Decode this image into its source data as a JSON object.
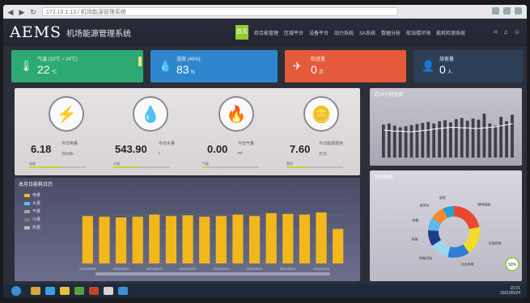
{
  "browser": {
    "url": "172.15.1.13 / 机场能源管理系统"
  },
  "header": {
    "logo": "AEMS",
    "system_name": "机场能源管理系统",
    "home_button": "首页",
    "menu": [
      "综合能管理",
      "区域平台",
      "设备平台",
      "动力系统",
      "SA系统",
      "数据分析",
      "航站楼环境",
      "能耗检测系统"
    ]
  },
  "kpis": [
    {
      "label": "气温 (10℃ ~ 24℃)",
      "value": "22",
      "unit": "℃",
      "color": "#2daa72",
      "icon": "thermometer-icon"
    },
    {
      "label": "湿度 (40%)",
      "value": "83",
      "unit": "%",
      "color": "#2f86cf",
      "icon": "droplet-icon"
    },
    {
      "label": "航班量",
      "value": "0",
      "unit": "次",
      "color": "#e45a3a",
      "icon": "airplane-icon"
    },
    {
      "label": "旅客量",
      "value": "0",
      "unit": "人",
      "color": "#2d3f56",
      "icon": "person-icon"
    }
  ],
  "energy": [
    {
      "icon": "lightning-icon",
      "value": "6.18",
      "sub": "今日电量",
      "unit": "万kWh",
      "bar_label": "电量",
      "fill": 0.55
    },
    {
      "icon": "water-drop-icon",
      "value": "543.90",
      "sub": "今日水量",
      "unit": "t",
      "bar_label": "水量",
      "fill": 0.45
    },
    {
      "icon": "flame-icon",
      "value": "0.00",
      "sub": "今日气量",
      "unit": "m³",
      "bar_label": "气量",
      "fill": 0.1
    },
    {
      "icon": "coins-icon",
      "value": "7.60",
      "sub": "今日能源费用",
      "unit": "万元",
      "bar_label": "费用",
      "fill": 0.35
    }
  ],
  "trend_chart": {
    "title": "近24小时负荷"
  },
  "chart_data": [
    {
      "type": "bar",
      "title": "本月日能耗日历",
      "legend": [
        "电量",
        "水量",
        "气量",
        "冷量",
        "热量"
      ],
      "legend_colors": [
        "#f2b81b",
        "#5ec2e3",
        "#a6a6a6",
        "#7a7a7a",
        "#bcbcbc"
      ],
      "categories": [
        "2021/05/08",
        "",
        "2021/05/10",
        "",
        "2021/05/13",
        "",
        "2021/05/15",
        "",
        "2021/05/17",
        "",
        "2021/05/19",
        "",
        "2021/05/21",
        "",
        "2021/05/23",
        ""
      ],
      "values": [
        6.6,
        6.5,
        6.4,
        6.5,
        6.8,
        6.6,
        6.7,
        6.5,
        6.6,
        6.8,
        6.6,
        7.0,
        6.9,
        6.8,
        7.1,
        4.8
      ],
      "ylim": [
        0,
        9
      ]
    },
    {
      "type": "bar",
      "title": "近24小时负荷",
      "values": [
        60,
        62,
        58,
        55,
        57,
        59,
        61,
        63,
        65,
        62,
        66,
        68,
        64,
        70,
        72,
        67,
        71,
        69,
        80,
        62,
        58,
        74,
        66,
        78
      ],
      "line": [
        50,
        49,
        48,
        48,
        47,
        47,
        48,
        49,
        50,
        52,
        53,
        54,
        55,
        55,
        54,
        54,
        53,
        53,
        54,
        55,
        56,
        58,
        60,
        62
      ],
      "ylim": [
        0,
        100
      ]
    },
    {
      "type": "pie",
      "title": "分项能耗",
      "labels": [
        "照明插座",
        "空调用电",
        "动力用电",
        "特殊用电",
        "其他",
        "电梯",
        "给排水",
        "厨房"
      ],
      "values": [
        22,
        18,
        14,
        12,
        10,
        8,
        9,
        7
      ],
      "colors": [
        "#e8492f",
        "#f0dc2b",
        "#2d7fd2",
        "#9fd6ee",
        "#1e3c8a",
        "#5cb8e8",
        "#f18a2e",
        "#2aa0d8"
      ],
      "center_text": "50%"
    }
  ],
  "taskbar": {
    "time": "15:21",
    "date": "2021/05/24"
  }
}
